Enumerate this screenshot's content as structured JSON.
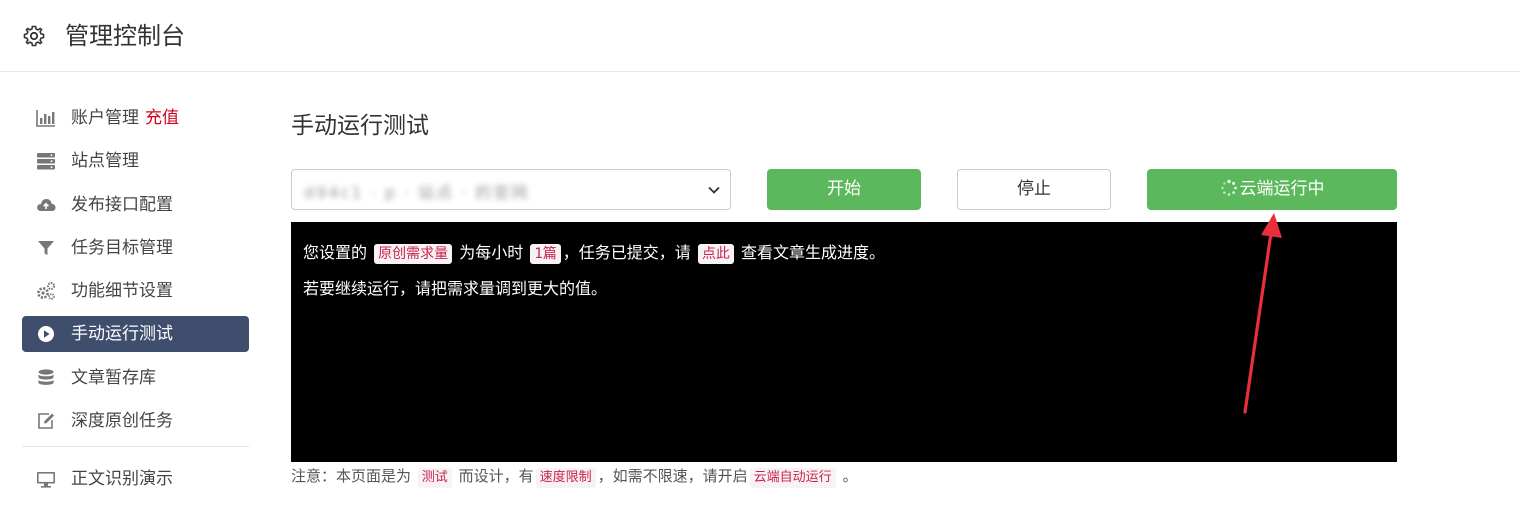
{
  "header": {
    "title": "管理控制台",
    "icon": "gear-icon"
  },
  "sidebar": {
    "items": [
      {
        "label": "账户管理",
        "extra": "充值",
        "icon": "bar-chart-icon"
      },
      {
        "label": "站点管理",
        "icon": "server-icon"
      },
      {
        "label": "发布接口配置",
        "icon": "cloud-upload-icon"
      },
      {
        "label": "任务目标管理",
        "icon": "filter-icon"
      },
      {
        "label": "功能细节设置",
        "icon": "cogs-icon"
      },
      {
        "label": "手动运行测试",
        "icon": "play-circle-icon",
        "active": true
      },
      {
        "label": "文章暂存库",
        "icon": "database-icon"
      },
      {
        "label": "深度原创任务",
        "icon": "edit-icon"
      },
      {
        "label": "正文识别演示",
        "icon": "monitor-icon"
      }
    ]
  },
  "main": {
    "title": "手动运行测试",
    "select_value": "d94c1 · p · 站点 · 的官网",
    "buttons": {
      "start": "开始",
      "stop": "停止",
      "cloud": "云端运行中"
    },
    "console": {
      "line1": {
        "t1": "您设置的",
        "tag1": "原创需求量",
        "t2": "为每小时",
        "tag2": "1篇",
        "t3": "，任务已提交，请",
        "tag3": "点此",
        "t4": "查看文章生成进度。"
      },
      "line2": "若要继续运行，请把需求量调到更大的值。"
    },
    "note": {
      "t1": "注意：本页面是为",
      "tag1": "测试",
      "t2": "而设计，有",
      "tag2": "速度限制",
      "t3": "，如需不限速，请开启",
      "tag3": "云端自动运行",
      "t4": "。"
    }
  },
  "colors": {
    "accent": "#5cb85c",
    "nav_active": "#3e4e6c",
    "recharge": "#d0021b",
    "arrow": "#e8303a"
  }
}
